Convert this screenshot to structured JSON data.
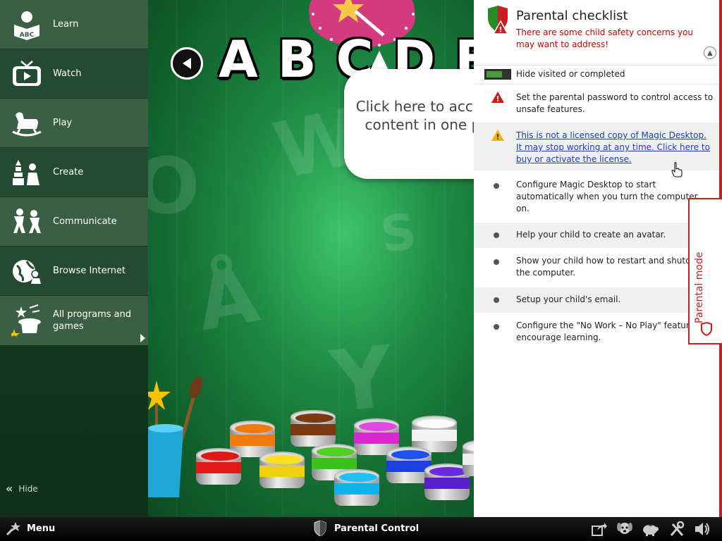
{
  "sidebar": {
    "items": [
      {
        "label": "Learn",
        "icon": "abc-book-icon"
      },
      {
        "label": "Watch",
        "icon": "tv-icon"
      },
      {
        "label": "Play",
        "icon": "rocking-horse-icon"
      },
      {
        "label": "Create",
        "icon": "building-blocks-icon"
      },
      {
        "label": "Communicate",
        "icon": "children-icon"
      },
      {
        "label": "Browse Internet",
        "icon": "globe-icon"
      },
      {
        "label": "All programs and games",
        "icon": "magic-hat-icon"
      }
    ],
    "hide_label": "Hide"
  },
  "main": {
    "letters": [
      "A",
      "B",
      "C",
      "D",
      "E"
    ],
    "bubble_text": "Click here to access the content in one place!",
    "ghost_letters": [
      "W",
      "S",
      "Å",
      "Y",
      "O"
    ]
  },
  "panel": {
    "title": "Parental checklist",
    "subtitle": "There are some child safety concerns you may want to address!",
    "hide_visited_label": "Hide visited or completed",
    "hide_visited_on": true,
    "tasks": [
      {
        "text": "Set the parental password to control access to unsafe features.",
        "status": "error"
      },
      {
        "text": "This is not a licensed copy of Magic Desktop. It may stop working at any time. Click here to buy or activate the license.",
        "status": "warning",
        "link": true
      },
      {
        "text": "Configure Magic Desktop to start automatically when you turn the computer on.",
        "status": "todo"
      },
      {
        "text": "Help your child to create an avatar.",
        "status": "todo"
      },
      {
        "text": "Show your child how to restart and shutdown the computer.",
        "status": "todo"
      },
      {
        "text": "Setup your child's email.",
        "status": "todo"
      },
      {
        "text": "Configure the \"No Work – No Play\" feature to encourage learning.",
        "status": "todo"
      }
    ],
    "parental_mode_label": "Parental mode"
  },
  "taskbar": {
    "menu_label": "Menu",
    "center_label": "Parental Control",
    "tray_icons": [
      "share-icon",
      "dog-icon",
      "piggy-bank-icon",
      "tools-icon",
      "speaker-icon"
    ]
  },
  "colors": {
    "accent_red": "#cc1e1e",
    "link_blue": "#1a3fb8",
    "sidebar_bg": "#173f23",
    "main_green": "#1f8c45",
    "toggle_green": "#4a9a3a"
  }
}
